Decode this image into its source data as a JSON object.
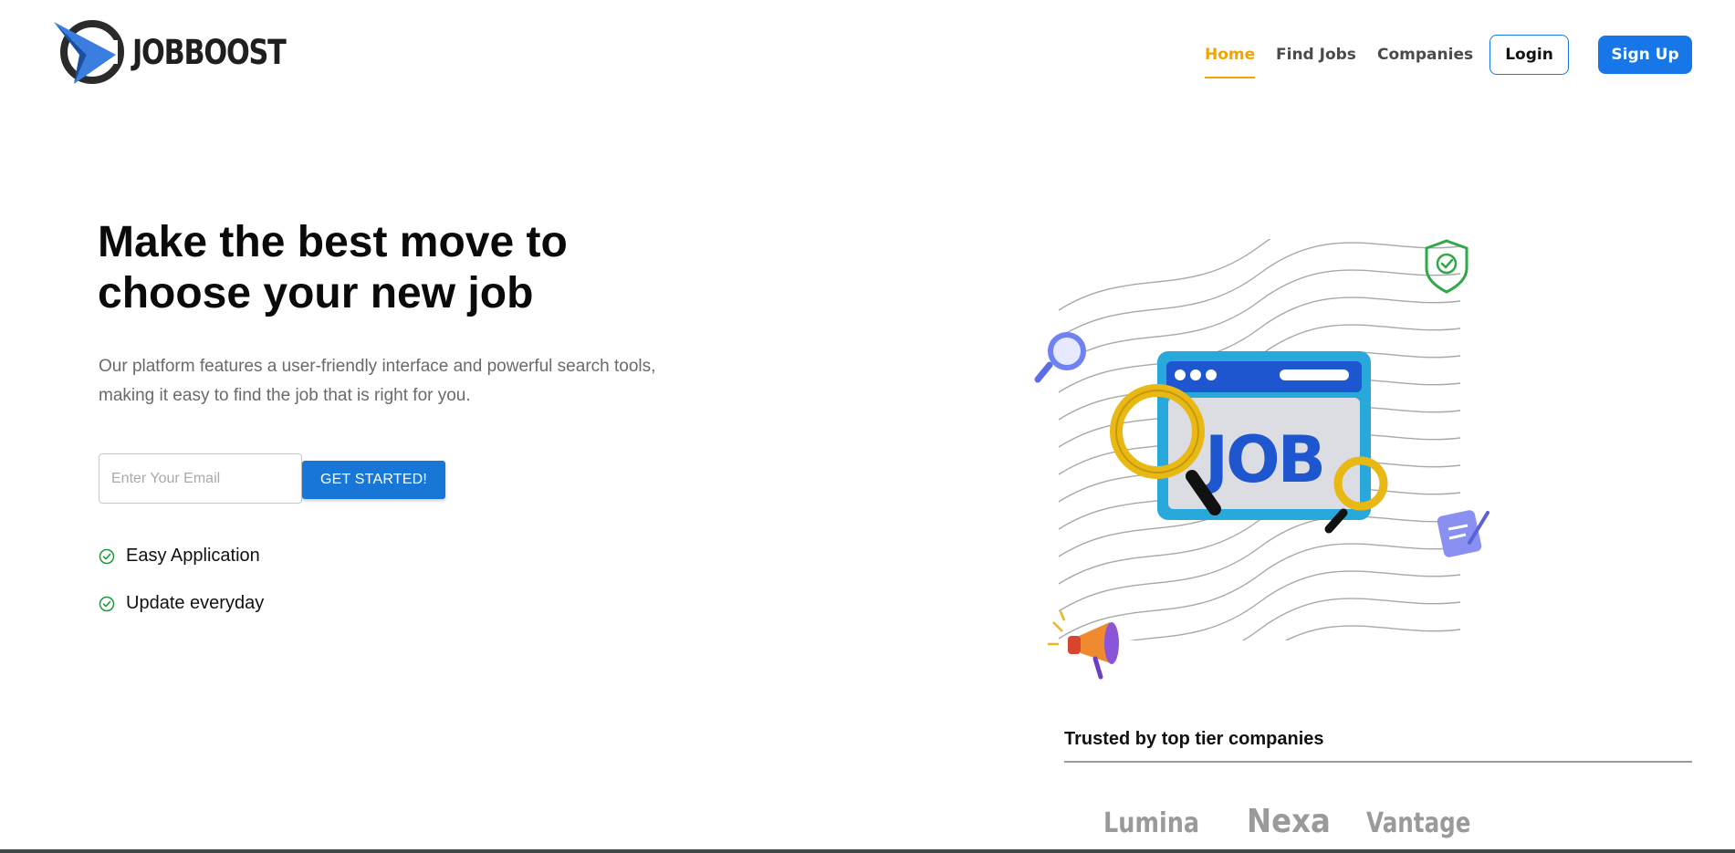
{
  "brand": {
    "name": "JOBBOOST"
  },
  "nav": {
    "items": [
      {
        "label": "Home",
        "active": true
      },
      {
        "label": "Find Jobs",
        "active": false
      },
      {
        "label": "Companies",
        "active": false
      }
    ],
    "login_label": "Login",
    "signup_label": "Sign Up"
  },
  "hero": {
    "title_line1": "Make the best move to",
    "title_line2": "choose your new job",
    "desc_line1": "Our platform features a user-friendly interface and powerful search tools,",
    "desc_line2": "making it easy to find the job that is right for you.",
    "email_placeholder": "Enter Your Email",
    "cta_label": "GET STARTED!",
    "features": [
      "Easy Application",
      "Update everyday"
    ]
  },
  "illustration": {
    "job_label": "JOB"
  },
  "trusted": {
    "title": "Trusted by top tier companies",
    "companies": [
      "Lumina",
      "Nexa",
      "Vantage"
    ]
  },
  "colors": {
    "primary": "#1877e8",
    "accent": "#f4a300",
    "check": "#1a9a3a",
    "logo_dark": "#2b2b2b",
    "logo_blue": "#3a7ee0"
  },
  "icons": {
    "logo": "logo-arrow-icon",
    "check": "check-circle-icon",
    "shield": "shield-check-icon",
    "magnifier": "magnifier-icon",
    "megaphone": "megaphone-icon",
    "notepad": "notepad-icon"
  }
}
